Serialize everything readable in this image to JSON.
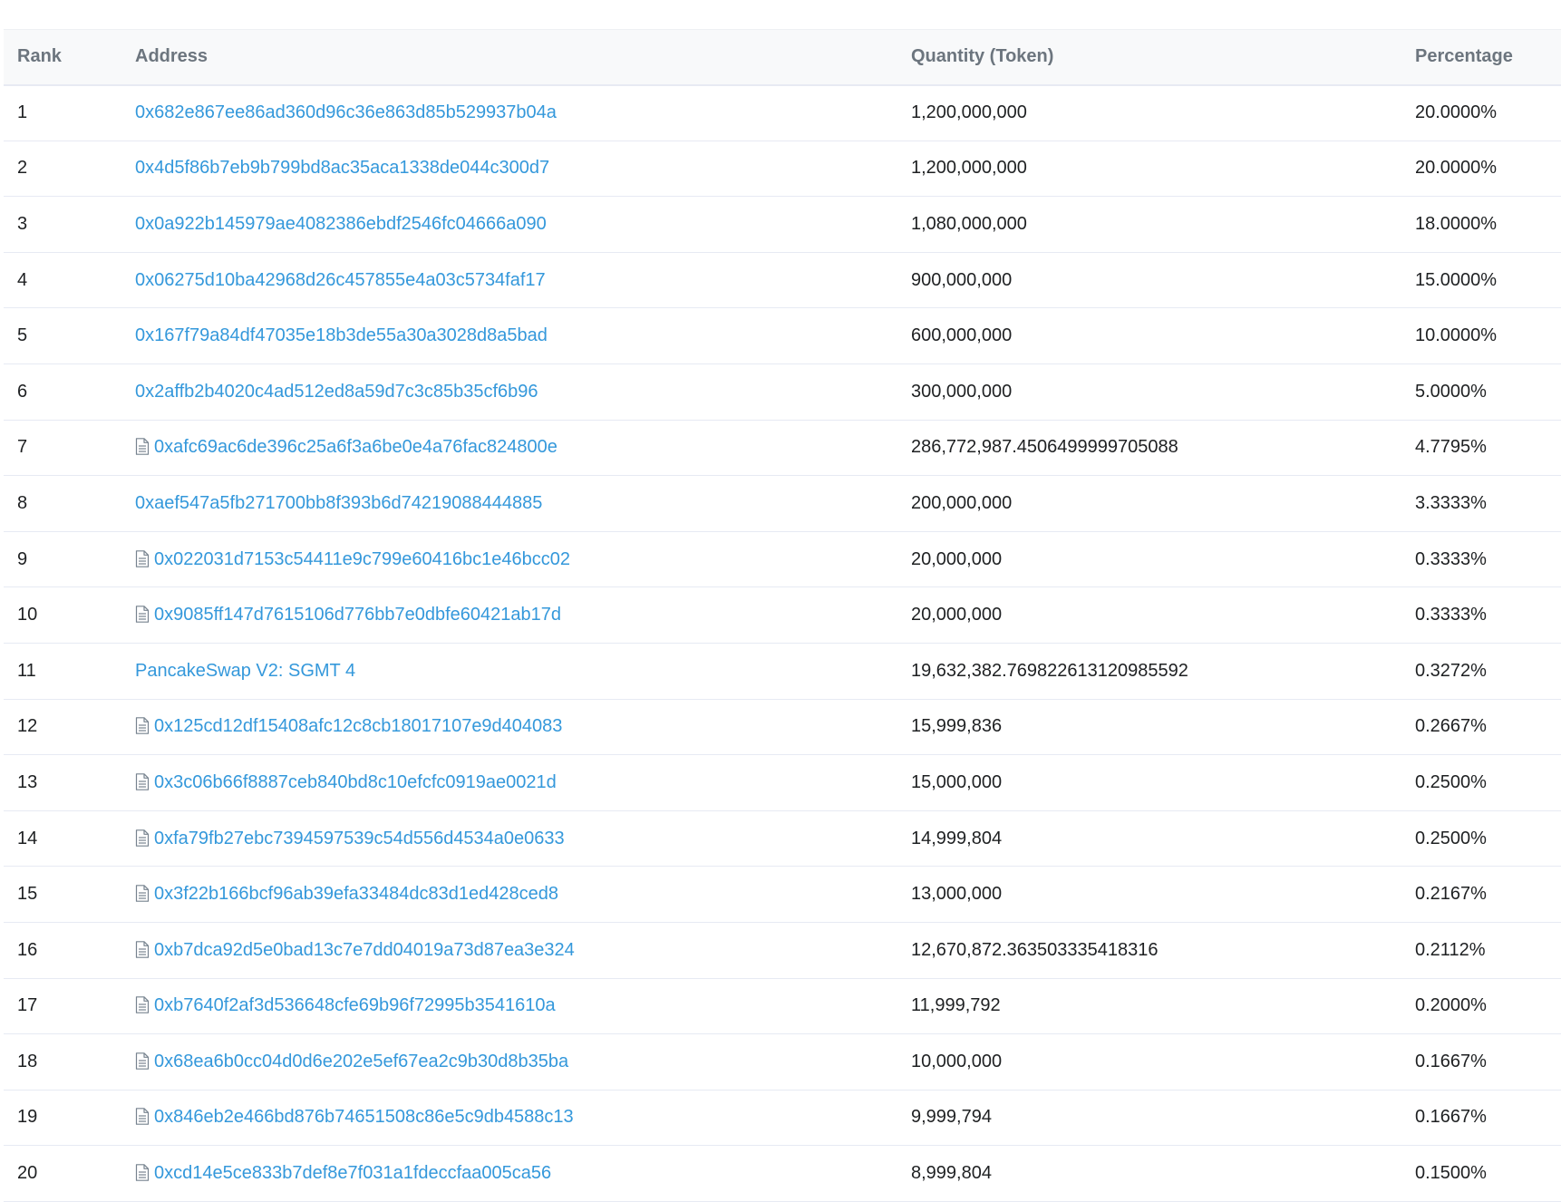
{
  "table": {
    "headers": {
      "rank": "Rank",
      "address": "Address",
      "quantity": "Quantity (Token)",
      "percentage": "Percentage"
    },
    "rows": [
      {
        "rank": "1",
        "address": "0x682e867ee86ad360d96c36e863d85b529937b04a",
        "contract": false,
        "quantity": "1,200,000,000",
        "percentage": "20.0000%"
      },
      {
        "rank": "2",
        "address": "0x4d5f86b7eb9b799bd8ac35aca1338de044c300d7",
        "contract": false,
        "quantity": "1,200,000,000",
        "percentage": "20.0000%"
      },
      {
        "rank": "3",
        "address": "0x0a922b145979ae4082386ebdf2546fc04666a090",
        "contract": false,
        "quantity": "1,080,000,000",
        "percentage": "18.0000%"
      },
      {
        "rank": "4",
        "address": "0x06275d10ba42968d26c457855e4a03c5734faf17",
        "contract": false,
        "quantity": "900,000,000",
        "percentage": "15.0000%"
      },
      {
        "rank": "5",
        "address": "0x167f79a84df47035e18b3de55a30a3028d8a5bad",
        "contract": false,
        "quantity": "600,000,000",
        "percentage": "10.0000%"
      },
      {
        "rank": "6",
        "address": "0x2affb2b4020c4ad512ed8a59d7c3c85b35cf6b96",
        "contract": false,
        "quantity": "300,000,000",
        "percentage": "5.0000%"
      },
      {
        "rank": "7",
        "address": "0xafc69ac6de396c25a6f3a6be0e4a76fac824800e",
        "contract": true,
        "quantity": "286,772,987.4506499999705088",
        "percentage": "4.7795%"
      },
      {
        "rank": "8",
        "address": "0xaef547a5fb271700bb8f393b6d74219088444885",
        "contract": false,
        "quantity": "200,000,000",
        "percentage": "3.3333%"
      },
      {
        "rank": "9",
        "address": "0x022031d7153c54411e9c799e60416bc1e46bcc02",
        "contract": true,
        "quantity": "20,000,000",
        "percentage": "0.3333%"
      },
      {
        "rank": "10",
        "address": "0x9085ff147d7615106d776bb7e0dbfe60421ab17d",
        "contract": true,
        "quantity": "20,000,000",
        "percentage": "0.3333%"
      },
      {
        "rank": "11",
        "address": "PancakeSwap V2: SGMT 4",
        "contract": false,
        "quantity": "19,632,382.769822613120985592",
        "percentage": "0.3272%"
      },
      {
        "rank": "12",
        "address": "0x125cd12df15408afc12c8cb18017107e9d404083",
        "contract": true,
        "quantity": "15,999,836",
        "percentage": "0.2667%"
      },
      {
        "rank": "13",
        "address": "0x3c06b66f8887ceb840bd8c10efcfc0919ae0021d",
        "contract": true,
        "quantity": "15,000,000",
        "percentage": "0.2500%"
      },
      {
        "rank": "14",
        "address": "0xfa79fb27ebc7394597539c54d556d4534a0e0633",
        "contract": true,
        "quantity": "14,999,804",
        "percentage": "0.2500%"
      },
      {
        "rank": "15",
        "address": "0x3f22b166bcf96ab39efa33484dc83d1ed428ced8",
        "contract": true,
        "quantity": "13,000,000",
        "percentage": "0.2167%"
      },
      {
        "rank": "16",
        "address": "0xb7dca92d5e0bad13c7e7dd04019a73d87ea3e324",
        "contract": true,
        "quantity": "12,670,872.363503335418316",
        "percentage": "0.2112%"
      },
      {
        "rank": "17",
        "address": "0xb7640f2af3d536648cfe69b96f72995b3541610a",
        "contract": true,
        "quantity": "11,999,792",
        "percentage": "0.2000%"
      },
      {
        "rank": "18",
        "address": "0x68ea6b0cc04d0d6e202e5ef67ea2c9b30d8b35ba",
        "contract": true,
        "quantity": "10,000,000",
        "percentage": "0.1667%"
      },
      {
        "rank": "19",
        "address": "0x846eb2e466bd876b74651508c86e5c9db4588c13",
        "contract": true,
        "quantity": "9,999,794",
        "percentage": "0.1667%"
      },
      {
        "rank": "20",
        "address": "0xcd14e5ce833b7def8e7f031a1fdeccfaa005ca56",
        "contract": true,
        "quantity": "8,999,804",
        "percentage": "0.1500%"
      }
    ]
  },
  "icons": {
    "contract": "document-icon"
  },
  "colors": {
    "link": "#3498db",
    "header_bg": "#f8f9fa",
    "header_text": "#6c757e",
    "row_divider": "#e7eaf3"
  }
}
